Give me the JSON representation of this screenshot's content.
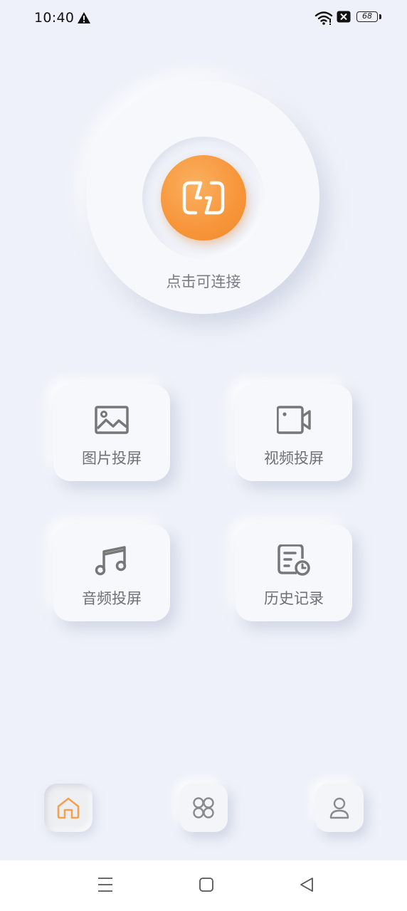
{
  "status_bar": {
    "time": "10:40",
    "battery": "68",
    "icons": [
      "warning-icon",
      "wifi-icon",
      "sim-off-icon",
      "battery-icon"
    ]
  },
  "connect": {
    "label": "点击可连接",
    "accent_color": "#f7953a",
    "icon": "connection-icon"
  },
  "features": [
    {
      "label": "图片投屏",
      "icon": "image-icon"
    },
    {
      "label": "视频投屏",
      "icon": "video-camera-icon"
    },
    {
      "label": "音频投屏",
      "icon": "music-note-icon"
    },
    {
      "label": "历史记录",
      "icon": "history-document-icon"
    }
  ],
  "tabs": [
    {
      "name": "home",
      "icon": "home-icon",
      "active": true,
      "color": "#f5a24e"
    },
    {
      "name": "apps",
      "icon": "apps-grid-icon",
      "active": false,
      "color": "#8a8a8e"
    },
    {
      "name": "profile",
      "icon": "person-icon",
      "active": false,
      "color": "#8a8a8e"
    }
  ],
  "system_nav": [
    "menu-icon",
    "home-square-icon",
    "back-triangle-icon"
  ]
}
